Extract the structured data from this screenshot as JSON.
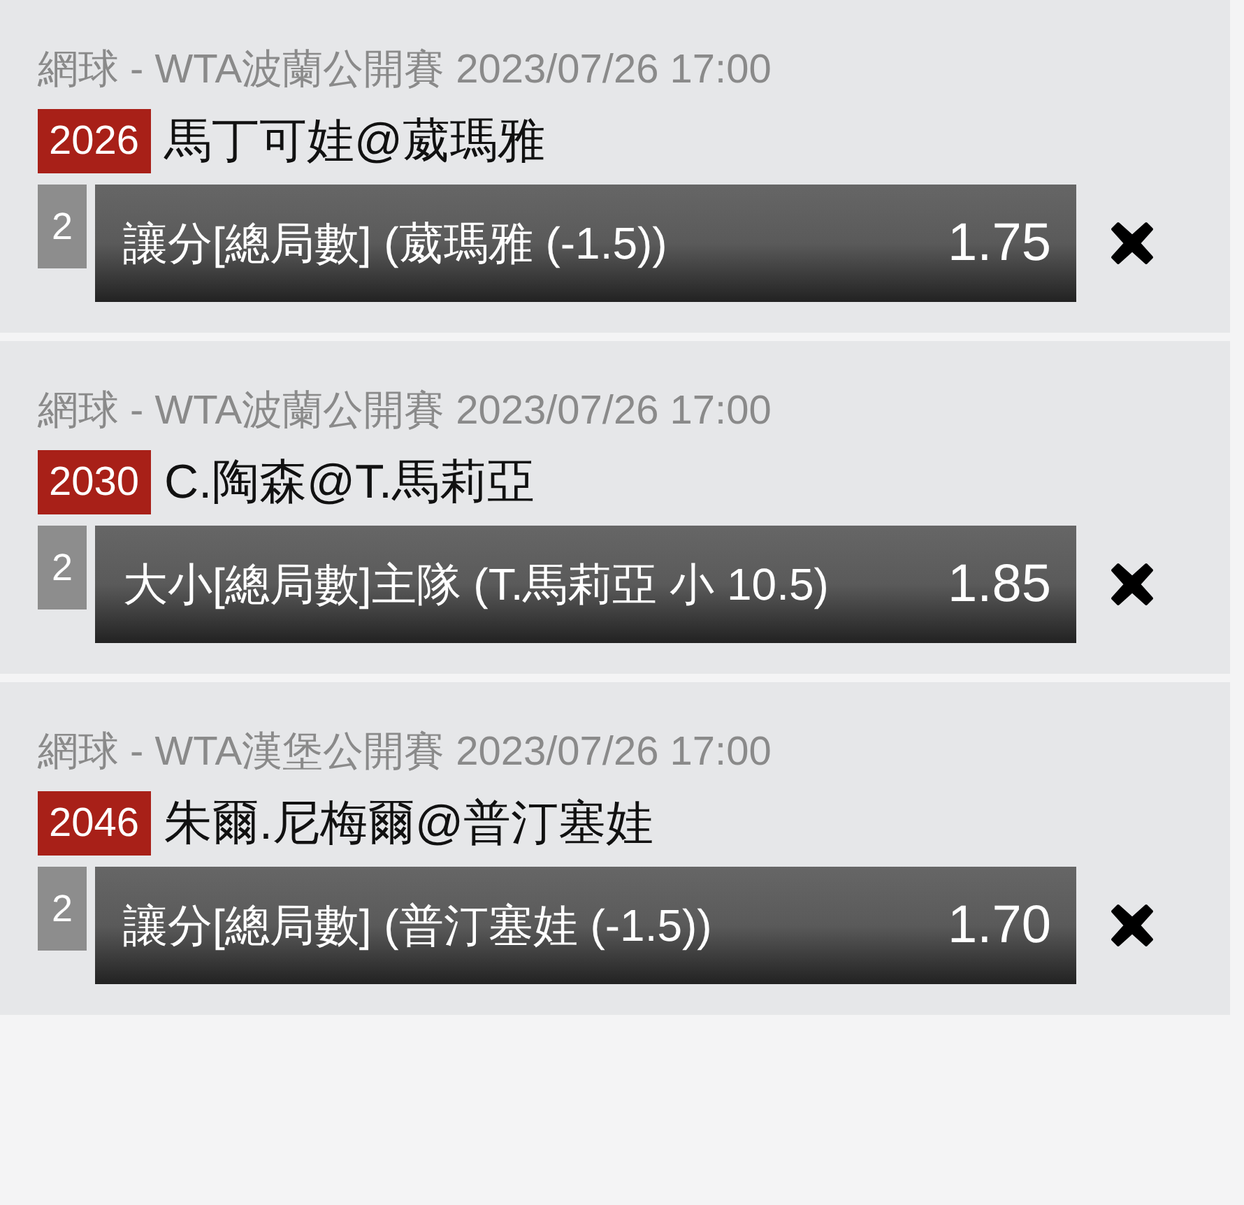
{
  "bets": [
    {
      "event": "網球 - WTA波蘭公開賽 2023/07/26 17:00",
      "match_no": "2026",
      "match": "馬丁可娃@葳瑪雅",
      "count": "2",
      "selection": "讓分[總局數] (葳瑪雅 (-1.5))",
      "odds": "1.75"
    },
    {
      "event": "網球 - WTA波蘭公開賽 2023/07/26 17:00",
      "match_no": "2030",
      "match": "C.陶森@T.馬莉亞",
      "count": "2",
      "selection": "大小[總局數]主隊 (T.馬莉亞 小 10.5)",
      "odds": "1.85"
    },
    {
      "event": "網球 - WTA漢堡公開賽 2023/07/26 17:00",
      "match_no": "2046",
      "match": "朱爾.尼梅爾@普汀塞娃",
      "count": "2",
      "selection": "讓分[總局數] (普汀塞娃 (-1.5))",
      "odds": "1.70"
    }
  ]
}
